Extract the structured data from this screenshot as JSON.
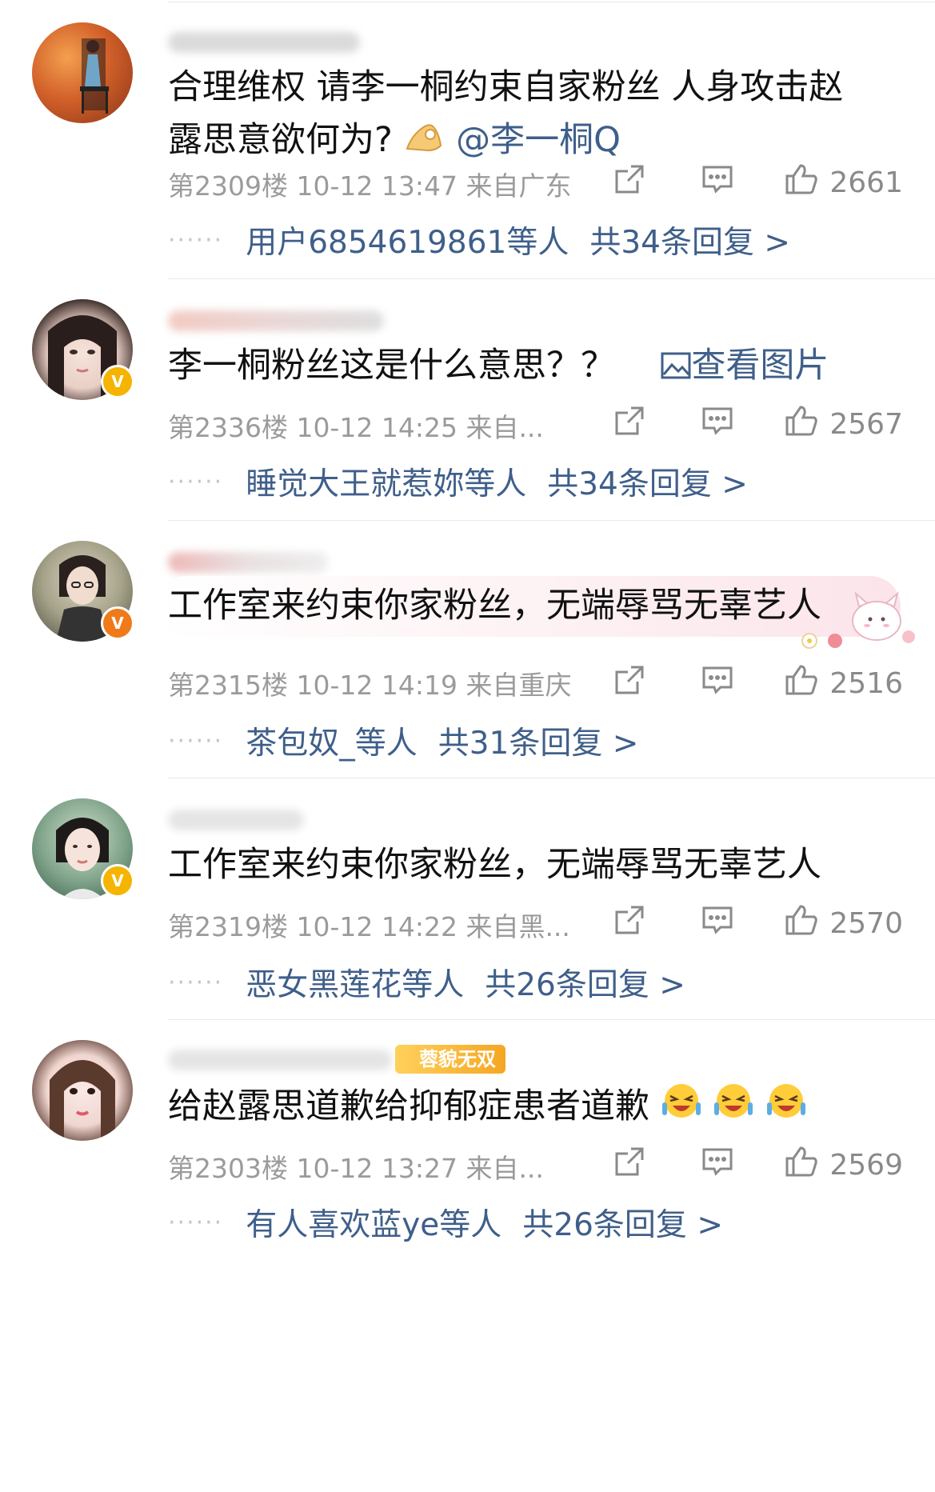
{
  "comments": [
    {
      "text_main": "合理维权 请李一桐约束自家粉丝 人身攻击赵",
      "text_line2": "露思意欲何为?",
      "mention": "@李一桐Q",
      "meta": "第2309楼 10-12 13:47 来自广东",
      "likes": "2661",
      "reply_users": "用户6854619861等人",
      "reply_total": "共34条回复 >"
    },
    {
      "text_main": "李一桐粉丝这是什么意思？？",
      "image_link": "查看图片",
      "meta": "第2336楼 10-12 14:25 来自...",
      "likes": "2567",
      "reply_users": "睡觉大王就惹妳等人",
      "reply_total": "共34条回复 >"
    },
    {
      "text_main": "工作室来约束你家粉丝，无端辱骂无辜艺人",
      "meta": "第2315楼 10-12 14:19 来自重庆",
      "likes": "2516",
      "reply_users": "茶包奴_等人",
      "reply_total": "共31条回复 >"
    },
    {
      "text_main": "工作室来约束你家粉丝，无端辱骂无辜艺人",
      "meta": "第2319楼 10-12 14:22 来自黑...",
      "likes": "2570",
      "reply_users": "恶女黑莲花等人",
      "reply_total": "共26条回复 >"
    },
    {
      "text_main": "给赵露思道歉给抑郁症患者道歉",
      "badge": "蓉貌无双",
      "meta": "第2303楼 10-12 13:27 来自...",
      "likes": "2569",
      "reply_users": "有人喜欢蓝ye等人",
      "reply_total": "共26条回复 >"
    }
  ],
  "icons": {
    "share": "share-icon",
    "comment": "comment-icon",
    "like": "like-icon",
    "image": "image-icon",
    "verified": "verified-badge"
  },
  "colors": {
    "link": "#3f5f8a",
    "meta": "#9b9b9b",
    "verified_gold": "#f5b400",
    "verified_orange": "#f07a1a"
  }
}
